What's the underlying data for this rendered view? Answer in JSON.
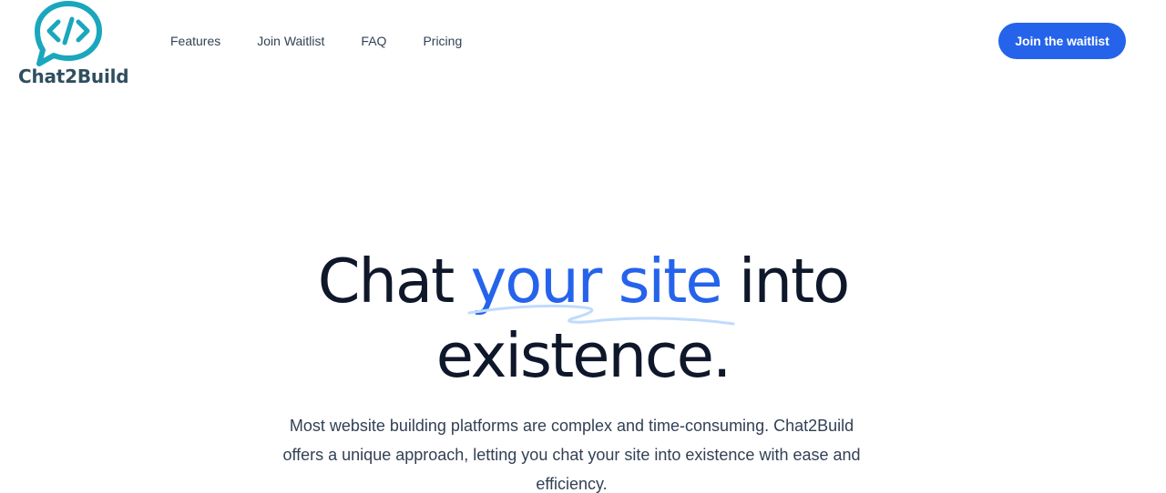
{
  "brand": {
    "name": "Chat2Build",
    "logo_icon": "chat-bubble-code-icon",
    "color": "#1aa7bd",
    "text_color": "#2f4f5f"
  },
  "nav": {
    "items": [
      "Features",
      "Join Waitlist",
      "FAQ",
      "Pricing"
    ]
  },
  "cta": {
    "label": "Join the waitlist",
    "color": "#2563eb"
  },
  "hero": {
    "title_before": "Chat ",
    "title_accent": "your site",
    "title_after": " into",
    "title_line2": "existence.",
    "accent_color": "#2563eb",
    "subtitle": "Most website building platforms are complex and time-consuming. Chat2Build offers a unique approach, letting you chat your site into existence with ease and efficiency."
  }
}
